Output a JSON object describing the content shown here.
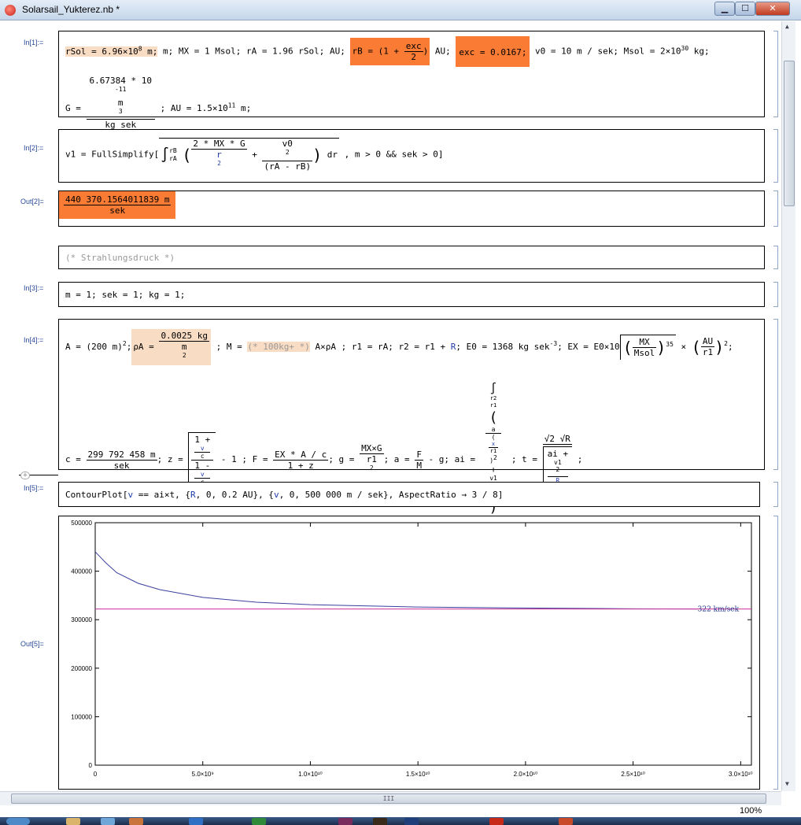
{
  "window": {
    "title": "Solarsail_Yukterez.nb *",
    "min": "▁",
    "max": "☐",
    "close": "✕"
  },
  "cells": {
    "in1": {
      "label": "In[1]:=",
      "l1a": "rSol = 6.96×10",
      "l1a_exp": "8",
      "l1b": " m; MX = 1 Msol; rA = 1.96 rSol; AU; ",
      "rB_pre": "rB = ",
      "rB_paren_open": "(1 + ",
      "rB_num": "exc",
      "rB_den": "2",
      "rB_paren_close": ")",
      "rB_post": " AU;",
      "exc": " exc = 0.0167;",
      "l1c": " v0 = 10 m / sek; Msol = 2×10",
      "l1c_exp": "30",
      "l1d": " kg;",
      "G_pre": "G = ",
      "G_num": "6.67384 * 10",
      "G_num_exp": "-11",
      "G_num_post": " m",
      "G_num_post_exp": "3",
      "G_den": "kg sek",
      "G_den_exp": "2",
      "G_post": " ; AU = 1.5×10",
      "G_post_exp": "11",
      "G_post_end": " m;"
    },
    "in2": {
      "label": "In[2]:=",
      "pre": "v1 = FullSimplify[",
      "int_upper": "rB",
      "int_lower": "rA",
      "t1_num": "2 * MX * G",
      "t1_den": "r",
      "t1_den_exp": "2",
      "plus": " + ",
      "t2_num": "v0",
      "t2_num_exp": "2",
      "t2_den": "(rA - rB)",
      "dr": " dr",
      "post": " , m > 0 && sek > 0]"
    },
    "out2": {
      "label": "Out[2]=",
      "num": "440 370.1564011839 m",
      "den": "sek"
    },
    "comment": {
      "text": "(* Strahlungsdruck *)"
    },
    "in3": {
      "label": "In[3]:=",
      "text": "m = 1; sek = 1; kg = 1;"
    },
    "in4": {
      "label": "In[4]:=",
      "a1": "A = (200 m)",
      "a1_exp": "2",
      "a1_end": ";",
      "rhoA_pre": " ρA = ",
      "rhoA_num": "0.0025 kg",
      "rhoA_den": "m",
      "rhoA_den_exp": "2",
      "a2": " ; M = ",
      "a2_comment": "(* 100kg+ *)",
      "a3": " A×ρA ; r1 = rA; r2 = r1 + ",
      "a3_R": "R",
      "a4": "; E0 = 1368 kg sek",
      "a4_exp": "-3",
      "a5": "; EX = E0×10",
      "sqrt_num": "MX",
      "sqrt_den": "Msol",
      "sqrt_exp": "35",
      "times": " × ",
      "au_num": "AU",
      "au_den": "r1",
      "au_exp": "2",
      "a6": ";",
      "c_pre": "c = ",
      "c_num": "299 792 458 m",
      "c_den": "sek",
      "z_pre": "; z = ",
      "z_num": "1 + ",
      "z_den": "1 - ",
      "z_v": "v",
      "z_c": "c",
      "z_post": " - 1 ; F = ",
      "F_num": "EX * A / c",
      "F_den": "1 + z",
      "g_pre": "; g = ",
      "g_num": "MX×G",
      "g_den": "r1",
      "g_den_exp": "2",
      "a_pre": "; a = ",
      "a_num": "F",
      "a_den": "M",
      "a_post": " - g; ai = ",
      "ai_upper": "r2",
      "ai_lower": "r1",
      "ai_inner_num": "a",
      "ai_x": "x",
      "ai_r1": "r1",
      "ai_sq": "2",
      "ai_plus": " + ",
      "ai_v1": "v1",
      "ai_v1_exp": "2",
      "ai_R": "R",
      "ai_dr": " dr",
      "ai_den": "R",
      "t_pre": " ; t = ",
      "t_num": "√2 √R",
      "t_den_pre": "ai + ",
      "t_den_v1": "v1",
      "t_den_v1_exp": "2",
      "t_den_R": "R",
      "t_end": " ;"
    },
    "in5": {
      "label": "In[5]:=",
      "pre": "ContourPlot[",
      "v": "v",
      "mid": " == ai×t, {",
      "R": "R",
      "r_rest": ", 0, 0.2 AU}, {",
      "v2": "v",
      "tail": ", 0, 500 000 m / sek}, AspectRatio → 3 / 8]"
    },
    "out5": {
      "label": "Out[5]="
    }
  },
  "chart_data": {
    "type": "line",
    "x_range": [
      0,
      30500000000
    ],
    "y_range": [
      0,
      500000
    ],
    "y_ticks": [
      0,
      100000,
      200000,
      300000,
      400000,
      500000
    ],
    "y_tick_labels": [
      "0",
      "100000",
      "200000",
      "300000",
      "400000",
      "500000"
    ],
    "x_ticks": [
      0,
      5000000000,
      10000000000,
      15000000000,
      20000000000,
      25000000000,
      30000000000
    ],
    "x_tick_labels": [
      "0",
      "5.0×10⁹",
      "1.0×10¹⁰",
      "1.5×10¹⁰",
      "2.0×10¹⁰",
      "2.5×10¹⁰",
      "3.0×10¹⁰"
    ],
    "series": [
      {
        "color": "#3b3f9e",
        "x": [
          0,
          500000000,
          1000000000,
          2000000000,
          3000000000,
          5000000000,
          7500000000,
          10000000000,
          15000000000,
          20000000000,
          25000000000,
          28000000000
        ],
        "y": [
          440000,
          417000,
          397000,
          375000,
          362000,
          346000,
          336000,
          331000,
          326000,
          324000,
          322500,
          322000
        ]
      },
      {
        "color": "#cc3399",
        "x": [
          0,
          30500000000
        ],
        "y": [
          322000,
          322000
        ]
      }
    ],
    "annotation": {
      "text": "322 km/sek",
      "x": 28000000000,
      "y": 322000
    }
  },
  "scroll": {
    "zoom": "100%",
    "grip": "III"
  }
}
